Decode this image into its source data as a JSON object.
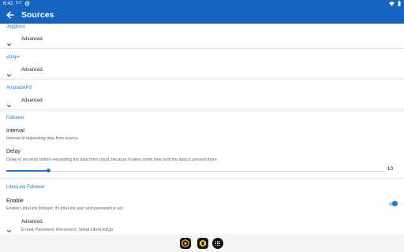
{
  "status_bar": {
    "time": "6:42",
    "tiny_label": "0.2",
    "icons": [
      "settings-icon",
      "wifi-icon",
      "battery-icon"
    ]
  },
  "app_bar": {
    "title": "Sources",
    "back_icon": "arrow-back-icon"
  },
  "sections": {
    "juggluco": {
      "title": "Juggluco",
      "advanced_label": "Advanced"
    },
    "xdrip": {
      "title": "xDrip+",
      "advanced_label": "Advanced"
    },
    "androidaps": {
      "title": "AndroidAPS",
      "advanced_label": "Advanced"
    },
    "follower": {
      "title": "Follower",
      "interval": {
        "title": "Interval",
        "summary": "Interval of requesting data from source."
      },
      "delay": {
        "title": "Delay",
        "summary": "Delay in seconds before requesting the data from cloud, because if takes some time until the data is present there.",
        "value": "10",
        "slider_fraction": 0.11
      }
    },
    "librelink_follower": {
      "title": "LibreLink Follower",
      "enable": {
        "title": "Enable",
        "summary": "Enable LibreLink follower, if LibreLink user and password is set.",
        "checked": true
      },
      "advanced": {
        "title": "Advanced",
        "summary": "E-mail, Password, Reconnect, Setup LibreLinkUp"
      }
    }
  },
  "nav_bar": {
    "apps": [
      "app-icon-1",
      "app-icon-2"
    ],
    "home_icon": "app-drawer-icon"
  },
  "colors": {
    "primary": "#1565c0",
    "accent": "#1e78d0",
    "divider": "#e3e3e3"
  }
}
